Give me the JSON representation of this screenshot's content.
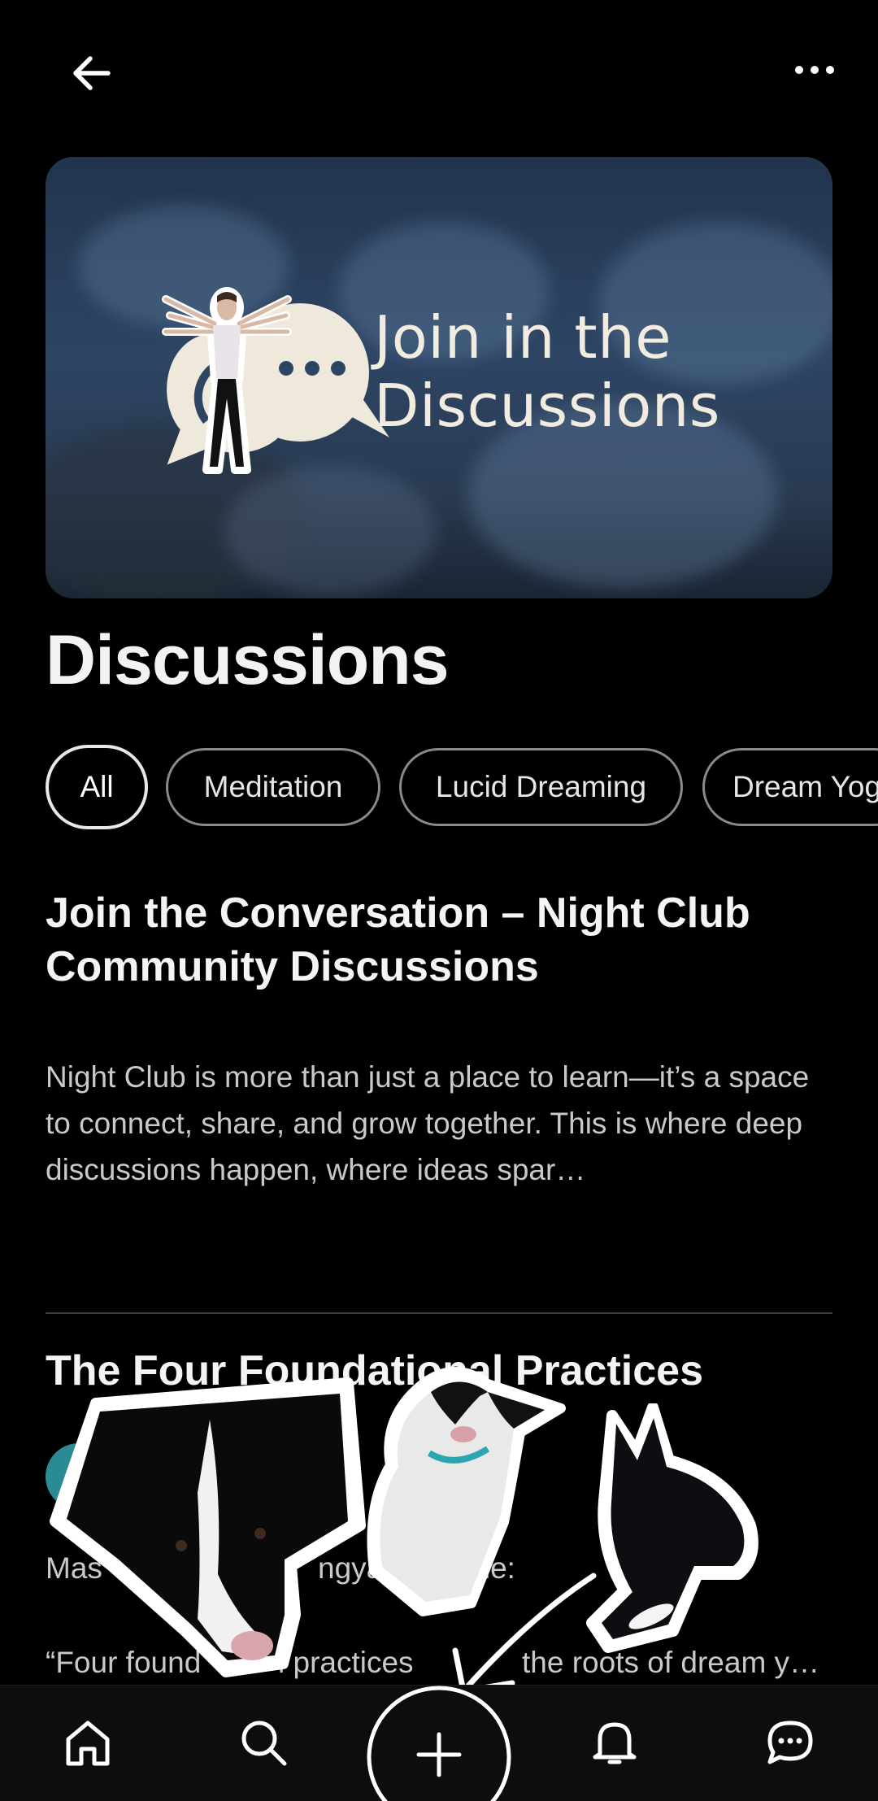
{
  "header": {
    "back_icon": "arrow-left-icon",
    "more_icon": "more-horizontal-icon"
  },
  "banner": {
    "line1": "Join in the",
    "line2": "Discussions"
  },
  "page_title": "Discussions",
  "filters": [
    {
      "label": "All",
      "active": true
    },
    {
      "label": "Meditation",
      "active": false
    },
    {
      "label": "Lucid Dreaming",
      "active": false
    },
    {
      "label": "Dream Yog",
      "active": false
    }
  ],
  "posts": [
    {
      "title": "Join the Conversation – Night Club Community Discussions",
      "excerpt": "Night Club is more than just a place to learn—it’s a space to connect, share, and grow together. This is where deep discussions happen, where ideas spar…"
    },
    {
      "title": "The Four Foundational Practices",
      "author": "Mas",
      "author_tail_1": "ngya",
      "author_tail_2": "che:",
      "excerpt": "“Four found",
      "excerpt_mid": "l practices",
      "excerpt_tail": "the roots of dream y…"
    }
  ],
  "bottom_nav": [
    {
      "name": "home",
      "icon": "home-icon"
    },
    {
      "name": "search",
      "icon": "search-icon"
    },
    {
      "name": "create",
      "icon": "plus-icon"
    },
    {
      "name": "notifications",
      "icon": "bell-icon"
    },
    {
      "name": "messages",
      "icon": "chat-icon"
    }
  ],
  "colors": {
    "background": "#000000",
    "text": "#f2f2f2",
    "muted_text": "#c9c9c9",
    "chip_border": "#8a8a8a",
    "avatar": "#2a8b96",
    "banner_text": "#f1ecdf"
  }
}
